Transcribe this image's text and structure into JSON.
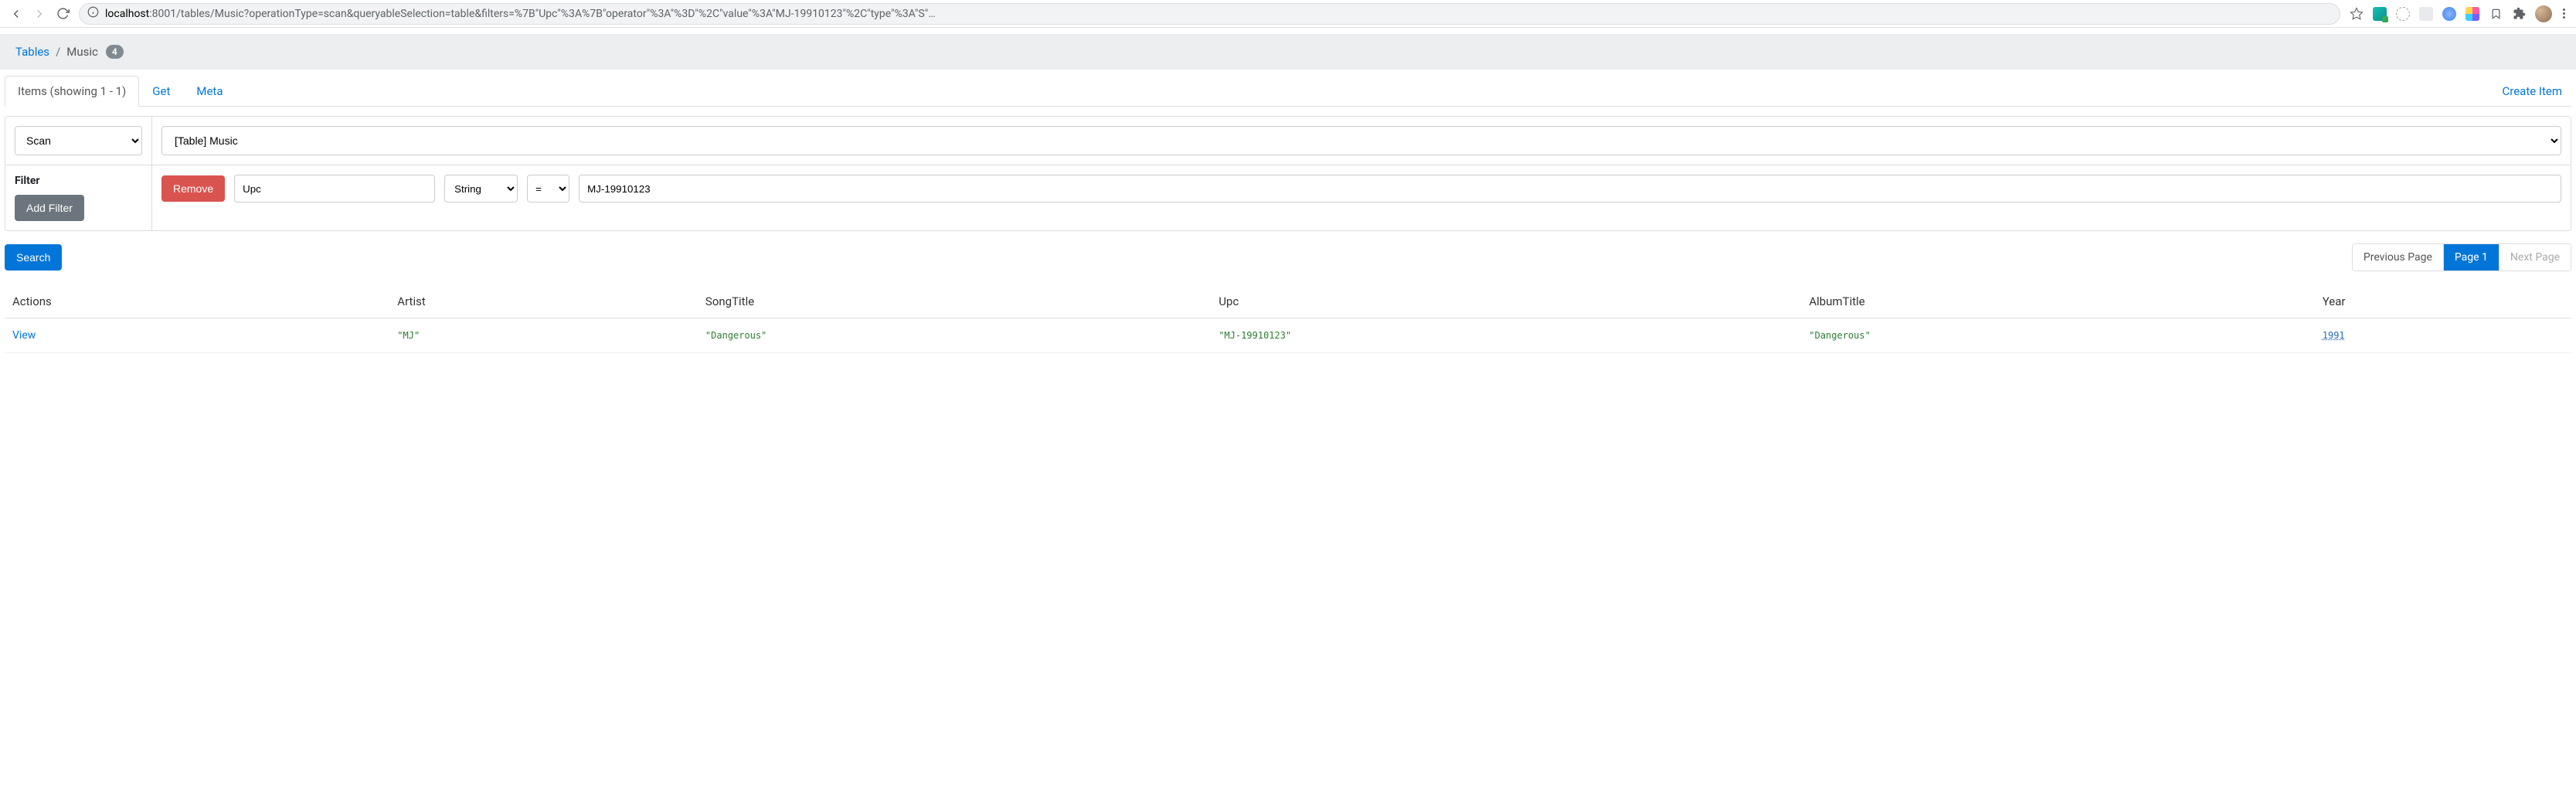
{
  "browser": {
    "url_host": "localhost",
    "url_port_path": ":8001/tables/Music?operationType=scan&queryableSelection=table&filters=%7B\"Upc\"%3A%7B\"operator\"%3A\"%3D\"%2C\"value\"%3A\"MJ-19910123\"%2C\"type\"%3A\"S\"…"
  },
  "breadcrumb": {
    "root": "Tables",
    "current": "Music",
    "badge": "4"
  },
  "tabs": {
    "items": "Items (showing 1 - 1)",
    "get": "Get",
    "meta": "Meta"
  },
  "create_link": "Create Item",
  "query": {
    "operation": "Scan",
    "table_select": "[Table] Music",
    "filter_label": "Filter",
    "add_filter": "Add Filter",
    "remove": "Remove",
    "attr": "Upc",
    "type": "String",
    "op": "=",
    "value": "MJ-19910123"
  },
  "actions": {
    "search": "Search"
  },
  "pagination": {
    "prev": "Previous Page",
    "page1": "Page 1",
    "next": "Next Page"
  },
  "table": {
    "headers": {
      "actions": "Actions",
      "artist": "Artist",
      "songtitle": "SongTitle",
      "upc": "Upc",
      "albumtitle": "AlbumTitle",
      "year": "Year"
    },
    "row": {
      "view": "View",
      "artist": "\"MJ\"",
      "songtitle": "\"Dangerous\"",
      "upc": "\"MJ-19910123\"",
      "albumtitle": "\"Dangerous\"",
      "year": "1991"
    }
  }
}
